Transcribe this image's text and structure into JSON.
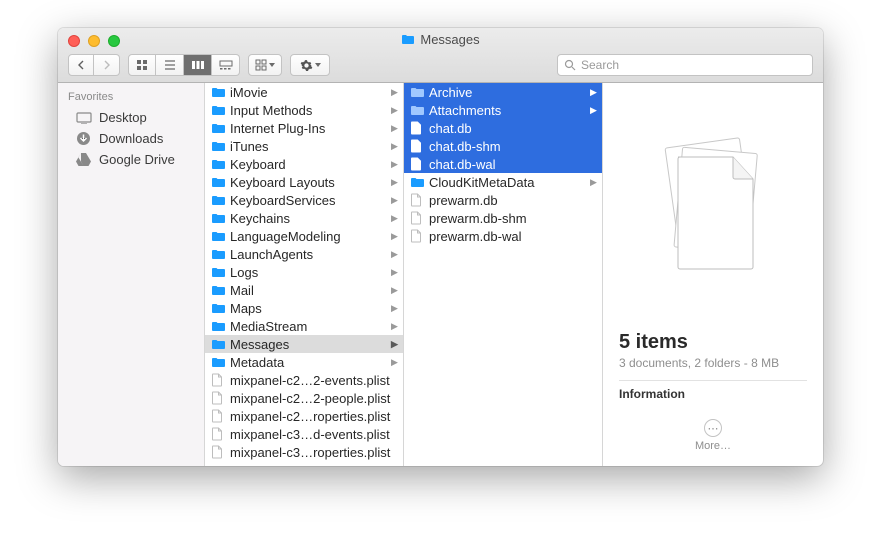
{
  "window_title": "Messages",
  "search_placeholder": "Search",
  "sidebar": {
    "header": "Favorites",
    "items": [
      {
        "label": "Desktop",
        "icon": "desktop"
      },
      {
        "label": "Downloads",
        "icon": "downloads"
      },
      {
        "label": "Google Drive",
        "icon": "gdrive"
      }
    ]
  },
  "column1": [
    {
      "label": "iMovie",
      "type": "folder",
      "hasChildren": true
    },
    {
      "label": "Input Methods",
      "type": "folder",
      "hasChildren": true
    },
    {
      "label": "Internet Plug-Ins",
      "type": "folder",
      "hasChildren": true
    },
    {
      "label": "iTunes",
      "type": "folder",
      "hasChildren": true
    },
    {
      "label": "Keyboard",
      "type": "folder",
      "hasChildren": true
    },
    {
      "label": "Keyboard Layouts",
      "type": "folder",
      "hasChildren": true
    },
    {
      "label": "KeyboardServices",
      "type": "folder",
      "hasChildren": true
    },
    {
      "label": "Keychains",
      "type": "folder",
      "hasChildren": true
    },
    {
      "label": "LanguageModeling",
      "type": "folder",
      "hasChildren": true
    },
    {
      "label": "LaunchAgents",
      "type": "folder",
      "hasChildren": true
    },
    {
      "label": "Logs",
      "type": "folder",
      "hasChildren": true
    },
    {
      "label": "Mail",
      "type": "folder",
      "hasChildren": true
    },
    {
      "label": "Maps",
      "type": "folder",
      "hasChildren": true
    },
    {
      "label": "MediaStream",
      "type": "folder",
      "hasChildren": true
    },
    {
      "label": "Messages",
      "type": "folder",
      "hasChildren": true,
      "highlighted": true
    },
    {
      "label": "Metadata",
      "type": "folder",
      "hasChildren": true
    },
    {
      "label": "mixpanel-c2…2-events.plist",
      "type": "file"
    },
    {
      "label": "mixpanel-c2…2-people.plist",
      "type": "file"
    },
    {
      "label": "mixpanel-c2…roperties.plist",
      "type": "file"
    },
    {
      "label": "mixpanel-c3…d-events.plist",
      "type": "file"
    },
    {
      "label": "mixpanel-c3…roperties.plist",
      "type": "file"
    }
  ],
  "column2": [
    {
      "label": "Archive",
      "type": "folder",
      "hasChildren": true,
      "selected": true
    },
    {
      "label": "Attachments",
      "type": "folder",
      "hasChildren": true,
      "selected": true
    },
    {
      "label": "chat.db",
      "type": "file",
      "selected": true
    },
    {
      "label": "chat.db-shm",
      "type": "file",
      "selected": true
    },
    {
      "label": "chat.db-wal",
      "type": "file",
      "selected": true
    },
    {
      "label": "CloudKitMetaData",
      "type": "folder",
      "hasChildren": true
    },
    {
      "label": "prewarm.db",
      "type": "file"
    },
    {
      "label": "prewarm.db-shm",
      "type": "file"
    },
    {
      "label": "prewarm.db-wal",
      "type": "file"
    }
  ],
  "preview": {
    "title": "5 items",
    "subtitle": "3 documents, 2 folders - 8 MB",
    "info_header": "Information",
    "more_label": "More…"
  }
}
